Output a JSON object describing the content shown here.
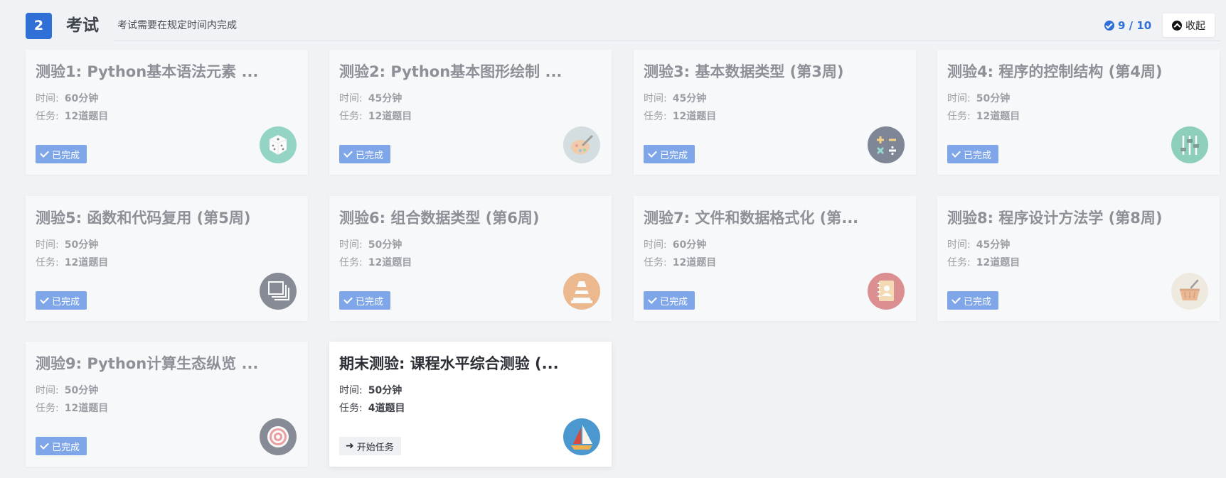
{
  "header": {
    "step_number": "2",
    "title": "考试",
    "description": "考试需要在规定时间内完成",
    "progress": "9 / 10",
    "collapse_label": "收起"
  },
  "labels": {
    "time": "时间:",
    "tasks": "任务:",
    "completed": "已完成",
    "start": "开始任务"
  },
  "cards": [
    {
      "title": "测验1: Python基本语法元素 ...",
      "time": "60分钟",
      "tasks": "12道题目",
      "status": "已完成",
      "icon": "dice-icon",
      "color": "#43b89a"
    },
    {
      "title": "测验2: Python基本图形绘制 ...",
      "time": "45分钟",
      "tasks": "12道题目",
      "status": "已完成",
      "icon": "palette-icon",
      "color": "#b9c9cc"
    },
    {
      "title": "测验3: 基本数据类型 (第3周)",
      "time": "45分钟",
      "tasks": "12道题目",
      "status": "已完成",
      "icon": "calculator-icon",
      "color": "#1e2b46"
    },
    {
      "title": "测验4: 程序的控制结构 (第4周)",
      "time": "50分钟",
      "tasks": "12道题目",
      "status": "已完成",
      "icon": "sliders-icon",
      "color": "#3aaf8a"
    },
    {
      "title": "测验5: 函数和代码复用 (第5周)",
      "time": "50分钟",
      "tasks": "12道题目",
      "status": "已完成",
      "icon": "layers-icon",
      "color": "#2a3345"
    },
    {
      "title": "测验6: 组合数据类型 (第6周)",
      "time": "50分钟",
      "tasks": "12道题目",
      "status": "已完成",
      "icon": "traffic-cone-icon",
      "color": "#e48536"
    },
    {
      "title": "测验7: 文件和数据格式化 (第...",
      "time": "60分钟",
      "tasks": "12道题目",
      "status": "已完成",
      "icon": "contacts-book-icon",
      "color": "#c53a3a"
    },
    {
      "title": "测验8: 程序设计方法学 (第8周)",
      "time": "45分钟",
      "tasks": "12道题目",
      "status": "已完成",
      "icon": "basket-icon",
      "color": "#e7e0cc"
    },
    {
      "title": "测验9: Python计算生态纵览 ...",
      "time": "50分钟",
      "tasks": "12道题目",
      "status": "已完成",
      "icon": "target-icon",
      "color": "#2a3345"
    },
    {
      "title": "期末测验: 课程水平综合测验 (...",
      "time": "50分钟",
      "tasks": "4道题目",
      "status": "开始任务",
      "icon": "sailboat-icon",
      "color": "#4a98cf"
    }
  ]
}
